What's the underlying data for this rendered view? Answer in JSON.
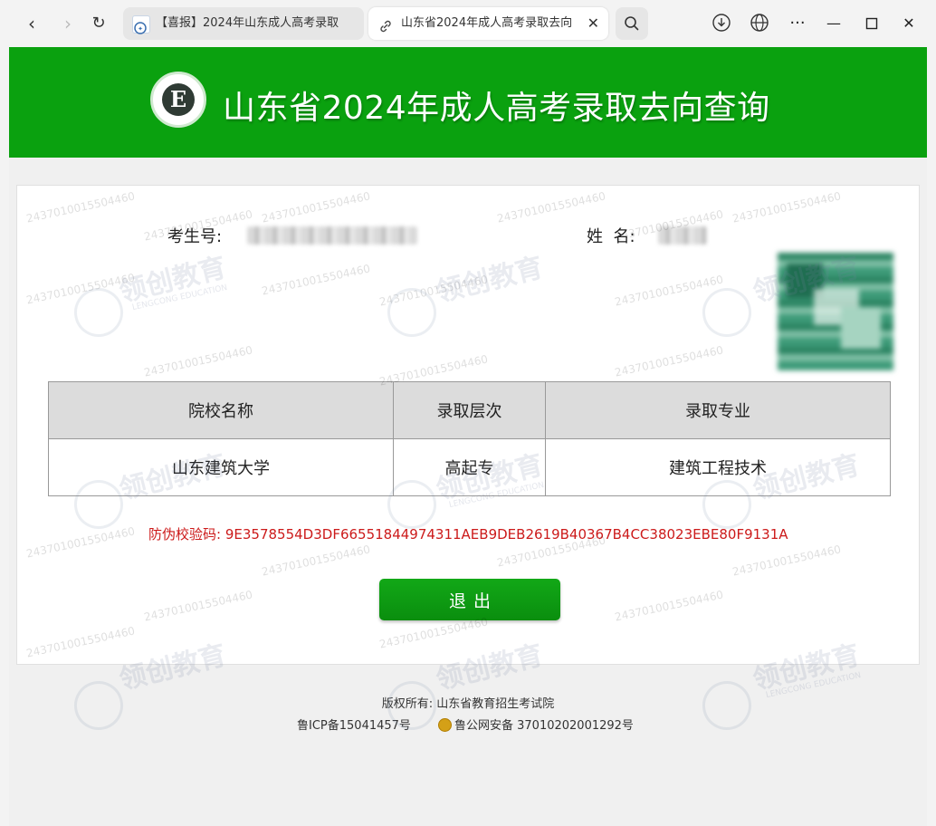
{
  "browser": {
    "tabs": [
      {
        "title": "【喜报】2024年山东成人高考录取",
        "active": false
      },
      {
        "title": "山东省2024年成人高考录取去向",
        "active": true
      }
    ],
    "nav": {
      "back": "‹",
      "forward": "›",
      "reload": "↻"
    },
    "icons": [
      "back-icon",
      "forward-icon",
      "reload-icon",
      "link-icon",
      "close-icon",
      "search-icon",
      "download-icon",
      "globe-icon",
      "more-icon",
      "minimize-icon",
      "maximize-icon",
      "window-close-icon"
    ]
  },
  "banner": {
    "logo_letter": "E",
    "title": "山东省2024年成人高考录取去向查询",
    "color": "#0aa10f"
  },
  "candidate": {
    "exam_no_label": "考生号:",
    "name_label": "姓  名:"
  },
  "table": {
    "headers": [
      "院校名称",
      "录取层次",
      "录取专业"
    ],
    "rows": [
      [
        "山东建筑大学",
        "高起专",
        "建筑工程技术"
      ]
    ]
  },
  "verify": {
    "label": "防伪校验码:",
    "code": "9E3578554D3DF66551844974311AEB9DEB2619B40367B4CC38023EBE80F9131A",
    "color": "#cc1a1a"
  },
  "exit_button": "退出",
  "footer": {
    "copyright": "版权所有: 山东省教育招生考试院",
    "icp": "鲁ICP备15041457号",
    "police": "鲁公网安备 37010202001292号"
  },
  "watermark": {
    "number": "2437010015504460",
    "brand": "领创教育",
    "brand_en": "LENGCONG EDUCATION"
  }
}
